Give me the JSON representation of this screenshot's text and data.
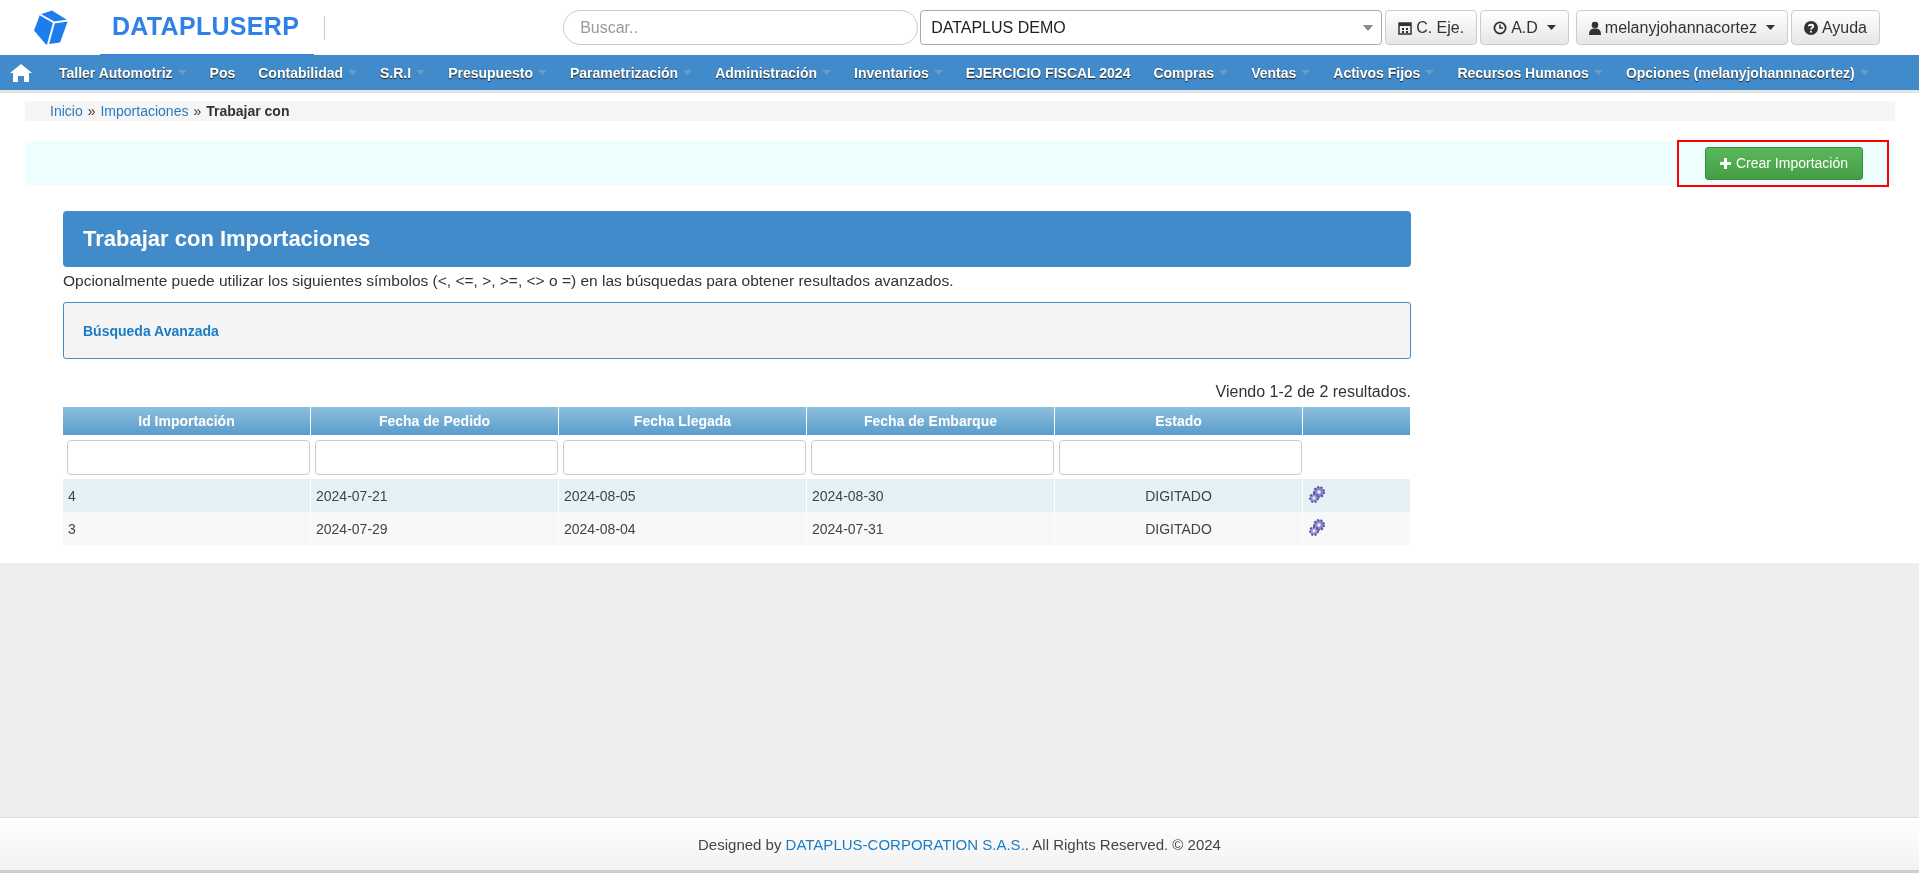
{
  "header": {
    "brand": "DATAPLUSERP",
    "search": {
      "placeholder": "Buscar.."
    },
    "company_select": {
      "value": "DATAPLUS DEMO"
    },
    "buttons": [
      {
        "kind": "calendar",
        "label": "C. Eje.",
        "dropdown": false
      },
      {
        "kind": "clock",
        "label": "A.D",
        "dropdown": true
      },
      {
        "kind": "user",
        "label": "melanyjohannacortez",
        "dropdown": true
      },
      {
        "kind": "help",
        "label": "Ayuda",
        "dropdown": false
      }
    ]
  },
  "menu": [
    {
      "label": "Taller Automotriz",
      "dropdown": true
    },
    {
      "label": "Pos",
      "dropdown": false
    },
    {
      "label": "Contabilidad",
      "dropdown": true
    },
    {
      "label": "S.R.I",
      "dropdown": true
    },
    {
      "label": "Presupuesto",
      "dropdown": true
    },
    {
      "label": "Parametrización",
      "dropdown": true
    },
    {
      "label": "Administración",
      "dropdown": true
    },
    {
      "label": "Inventarios",
      "dropdown": true
    },
    {
      "label": "EJERCICIO FISCAL 2024",
      "dropdown": false
    },
    {
      "label": "Compras",
      "dropdown": true
    },
    {
      "label": "Ventas",
      "dropdown": true
    },
    {
      "label": "Activos Fijos",
      "dropdown": true
    },
    {
      "label": "Recursos Humanos",
      "dropdown": true
    },
    {
      "label": "Opciones (melanyjohannnacortez)",
      "dropdown": true
    }
  ],
  "breadcrumb": [
    {
      "label": "Inicio",
      "link": true
    },
    {
      "separator": "»",
      "label": "Importaciones",
      "link": true
    },
    {
      "separator": "»",
      "label": "Trabajar con",
      "link": false
    }
  ],
  "create_button": {
    "label": "Crear Importación",
    "highlighted": true
  },
  "panel": {
    "title": "Trabajar con Importaciones",
    "description": "Opcionalmente puede utilizar los siguientes símbolos (<, <=, >, >=, <> o =) en las búsquedas para obtener resultados avanzados.",
    "advanced_search": "Búsqueda Avanzada"
  },
  "table": {
    "summary": "Viendo 1-2 de 2 resultados.",
    "columns": [
      "Id Importación",
      "Fecha de Pedido",
      "Fecha Llegada",
      "Fecha de Embarque",
      "Estado"
    ],
    "rows": [
      {
        "cells": [
          "4",
          "2024-07-21",
          "2024-08-05",
          "2024-08-30",
          "DIGITADO"
        ]
      },
      {
        "cells": [
          "3",
          "2024-07-29",
          "2024-08-04",
          "2024-07-31",
          "DIGITADO"
        ]
      }
    ]
  },
  "footer": {
    "prefix": "Designed by",
    "company": "DATAPLUS-CORPORATION S.A.S.",
    "suffix": ". All Rights Reserved. © 2024"
  }
}
